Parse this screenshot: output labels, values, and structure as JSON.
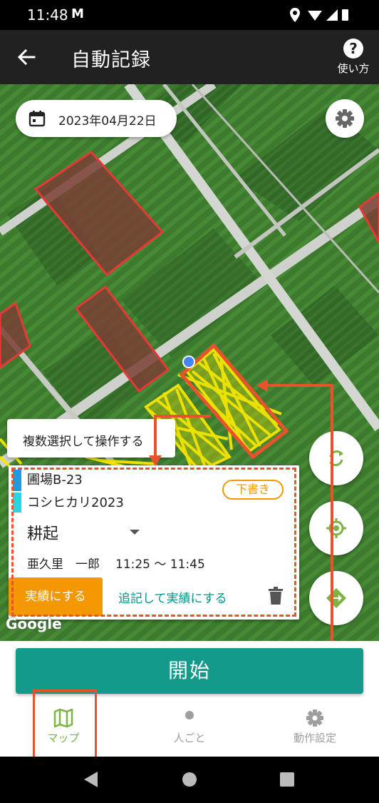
{
  "status_bar": {
    "time": "11:48",
    "notification_icon": "gmail-m-icon"
  },
  "app_bar": {
    "title": "自動記録",
    "help_label": "使い方"
  },
  "map": {
    "date": "2023年04月22日",
    "multi_select_label": "複数選択して操作する",
    "google_logo": "Google"
  },
  "record_card": {
    "field_name": "圃場B-23",
    "crop_name": "コシヒカリ2023",
    "status_badge": "下書き",
    "work_type": "耕起",
    "worker": "亜久里　一郎",
    "time_range": "11:25 ～ 11:45",
    "confirm_label": "実績にする",
    "append_label": "追記して実績にする"
  },
  "start_button": "開始",
  "bottom_nav": [
    {
      "label": "マップ",
      "icon": "map-icon",
      "active": true
    },
    {
      "label": "人ごと",
      "icon": "person-icon",
      "active": false
    },
    {
      "label": "動作設定",
      "icon": "gear-icon",
      "active": false
    }
  ],
  "colors": {
    "accent_teal": "#139a8b",
    "orange": "#f39800",
    "annotation_red": "#e8532b",
    "field_outline": "#e53935",
    "track_yellow": "#f5e600",
    "nav_active": "#7cb342",
    "nav_inactive": "#9e9e9e"
  }
}
